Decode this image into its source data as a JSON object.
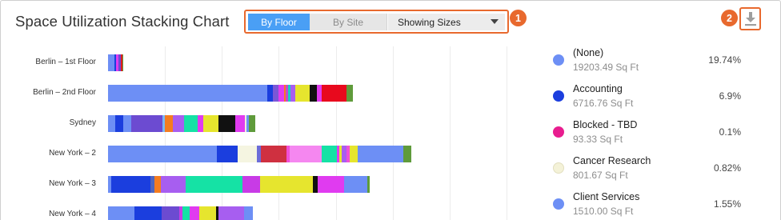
{
  "title": "Space Utilization Stacking Chart",
  "toolbar": {
    "by_floor_label": "By Floor",
    "by_site_label": "By Site",
    "dropdown_value": "Showing Sizes",
    "step1": "1",
    "step2": "2",
    "accent": "#e8692e"
  },
  "download_icon": "download-icon",
  "chart_data": {
    "type": "bar",
    "orientation": "horizontal-stacked",
    "unit": "Sq Ft",
    "categories": [
      "Berlin – 1st Floor",
      "Berlin – 2nd Floor",
      "Sydney",
      "New York – 2",
      "New York – 3",
      "New York – 4"
    ],
    "rows": [
      {
        "label": "Berlin – 1st Floor",
        "segments": [
          {
            "color": "#6d8ff5",
            "v": 8
          },
          {
            "color": "#1b3ede",
            "v": 2
          },
          {
            "color": "#e03bf0",
            "v": 3
          },
          {
            "color": "#6c4bd1",
            "v": 3
          },
          {
            "color": "#e21b1b",
            "v": 2
          },
          {
            "color": "#5f9b3b",
            "v": 1
          }
        ]
      },
      {
        "label": "Berlin – 2nd Floor",
        "segments": [
          {
            "color": "#6d8ff5",
            "v": 199
          },
          {
            "color": "#1b3ede",
            "v": 7
          },
          {
            "color": "#7b57d6",
            "v": 7
          },
          {
            "color": "#e03bf0",
            "v": 7
          },
          {
            "color": "#f47c20",
            "v": 2
          },
          {
            "color": "#c64acb",
            "v": 3
          },
          {
            "color": "#16d1c4",
            "v": 3
          },
          {
            "color": "#a75ef0",
            "v": 6
          },
          {
            "color": "#e6e52e",
            "v": 18
          },
          {
            "color": "#111111",
            "v": 9
          },
          {
            "color": "#e03bf0",
            "v": 6
          },
          {
            "color": "#e8091d",
            "v": 31
          },
          {
            "color": "#5f9b3b",
            "v": 8
          }
        ]
      },
      {
        "label": "Sydney",
        "segments": [
          {
            "color": "#6d8ff5",
            "v": 9
          },
          {
            "color": "#1b3ede",
            "v": 10
          },
          {
            "color": "#6d8ff5",
            "v": 10
          },
          {
            "color": "#6c4bd1",
            "v": 39
          },
          {
            "color": "#7ab7f5",
            "v": 3
          },
          {
            "color": "#f47c20",
            "v": 10
          },
          {
            "color": "#a75ef0",
            "v": 14
          },
          {
            "color": "#15e2a5",
            "v": 17
          },
          {
            "color": "#e03bf0",
            "v": 7
          },
          {
            "color": "#e6e52e",
            "v": 19
          },
          {
            "color": "#111111",
            "v": 21
          },
          {
            "color": "#e03bf0",
            "v": 12
          },
          {
            "color": "#eeeedb",
            "v": 2
          },
          {
            "color": "#6d8ff5",
            "v": 3
          },
          {
            "color": "#5f9b3b",
            "v": 8
          }
        ]
      },
      {
        "label": "New York – 2",
        "segments": [
          {
            "color": "#6d8ff5",
            "v": 136
          },
          {
            "color": "#1b3ede",
            "v": 26
          },
          {
            "color": "#f5f5e1",
            "v": 24
          },
          {
            "color": "#6c6cd8",
            "v": 5
          },
          {
            "color": "#cf3040",
            "v": 32
          },
          {
            "color": "#f04fd8",
            "v": 4
          },
          {
            "color": "#f587f0",
            "v": 40
          },
          {
            "color": "#15e2a5",
            "v": 19
          },
          {
            "color": "#e03bf0",
            "v": 3
          },
          {
            "color": "#e6e52e",
            "v": 3
          },
          {
            "color": "#a75ef0",
            "v": 6
          },
          {
            "color": "#f04fd8",
            "v": 4
          },
          {
            "color": "#e6e52e",
            "v": 10
          },
          {
            "color": "#6d8ff5",
            "v": 57
          },
          {
            "color": "#5f9b3b",
            "v": 10
          }
        ]
      },
      {
        "label": "New York – 3",
        "segments": [
          {
            "color": "#6d8ff5",
            "v": 4
          },
          {
            "color": "#1b3ede",
            "v": 49
          },
          {
            "color": "#4d65c0",
            "v": 5
          },
          {
            "color": "#f47c20",
            "v": 8
          },
          {
            "color": "#a75ef0",
            "v": 31
          },
          {
            "color": "#15e2a5",
            "v": 71
          },
          {
            "color": "#c83be6",
            "v": 22
          },
          {
            "color": "#e6e52e",
            "v": 66
          },
          {
            "color": "#111111",
            "v": 6
          },
          {
            "color": "#e03bf0",
            "v": 33
          },
          {
            "color": "#6d8ff5",
            "v": 29
          },
          {
            "color": "#5f9b3b",
            "v": 3
          }
        ]
      },
      {
        "label": "New York – 4",
        "segments": [
          {
            "color": "#6d8ff5",
            "v": 33
          },
          {
            "color": "#1b3ede",
            "v": 34
          },
          {
            "color": "#6c4bd1",
            "v": 22
          },
          {
            "color": "#c83be6",
            "v": 4
          },
          {
            "color": "#15e2a5",
            "v": 9
          },
          {
            "color": "#e03bf0",
            "v": 12
          },
          {
            "color": "#e6e52e",
            "v": 21
          },
          {
            "color": "#111111",
            "v": 3
          },
          {
            "color": "#a75ef0",
            "v": 32
          },
          {
            "color": "#6d8ff5",
            "v": 11
          }
        ]
      }
    ],
    "xlim": [
      0,
      360
    ]
  },
  "legend": [
    {
      "name": "(None)",
      "size": "19203.49 Sq Ft",
      "pct": "19.74%",
      "color": "#6d8ff5"
    },
    {
      "name": "Accounting",
      "size": "6716.76 Sq Ft",
      "pct": "6.9%",
      "color": "#1b3ede"
    },
    {
      "name": "Blocked - TBD",
      "size": "93.33 Sq Ft",
      "pct": "0.1%",
      "color": "#e81d8f"
    },
    {
      "name": "Cancer Research",
      "size": "801.67 Sq Ft",
      "pct": "0.82%",
      "color": "#f4f2d8"
    },
    {
      "name": "Client Services",
      "size": "1510.00 Sq Ft",
      "pct": "1.55%",
      "color": "#6d8ff5"
    }
  ]
}
